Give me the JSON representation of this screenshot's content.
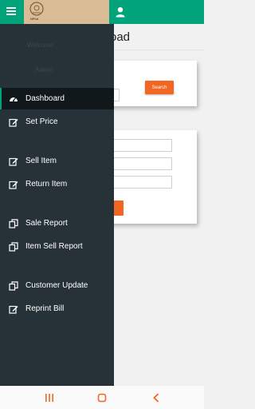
{
  "app": {
    "accent_color": "#00a37a",
    "drawer_color": "#263238",
    "action_color": "#f26522"
  },
  "header": {
    "page_title": "oad",
    "user_icon": "user-icon",
    "menu_icon": "hamburger-icon"
  },
  "logo": {
    "text": "NPkd"
  },
  "drawer": {
    "ghost_text": [
      "Welcome",
      "Admin"
    ],
    "items": [
      {
        "label": "Dashboard",
        "icon": "speedometer-icon",
        "active": true
      },
      {
        "label": "Set Price",
        "icon": "edit-icon"
      },
      {
        "label": "Sell Item",
        "icon": "edit-icon"
      },
      {
        "label": "Return Item",
        "icon": "edit-icon"
      },
      {
        "label": "Sale Report",
        "icon": "copy-icon"
      },
      {
        "label": "Item Sell Report",
        "icon": "copy-icon"
      },
      {
        "label": "Customer Update",
        "icon": "copy-icon"
      },
      {
        "label": "Reprint Bill",
        "icon": "edit-icon"
      }
    ]
  },
  "search_card": {
    "button_label": "Search"
  },
  "system_nav": {
    "recents_icon": "recents-icon",
    "home_icon": "home-icon",
    "back_icon": "back-icon"
  }
}
